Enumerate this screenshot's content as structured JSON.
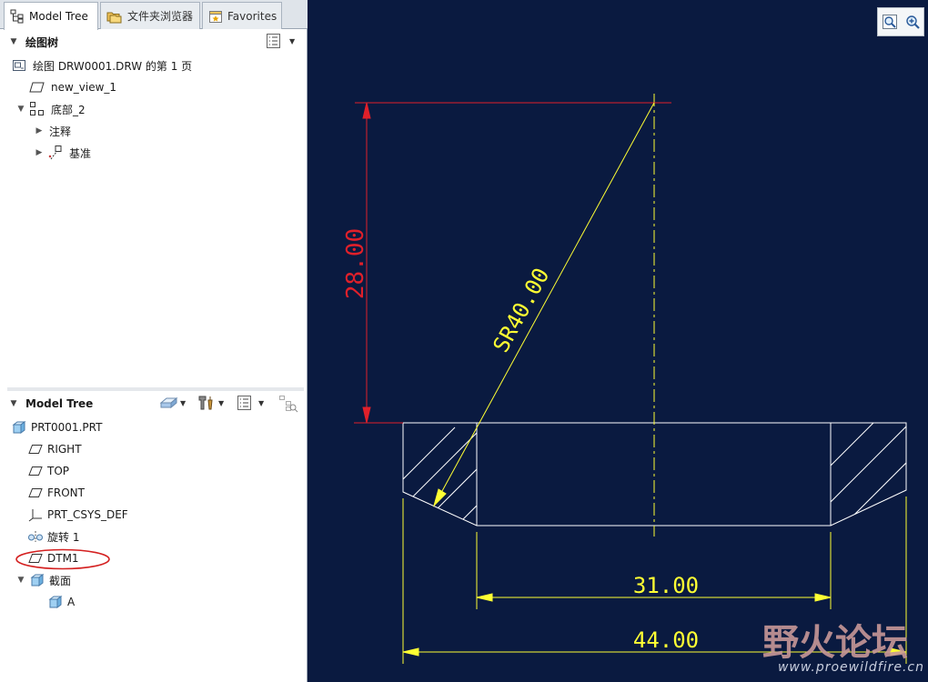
{
  "tabs": [
    {
      "label": "Model Tree",
      "icon": "model-tree-icon",
      "active": true
    },
    {
      "label": "文件夹浏览器",
      "icon": "folder-browser-icon",
      "active": false
    },
    {
      "label": "Favorites",
      "icon": "favorites-icon",
      "active": false
    }
  ],
  "drawing_tree": {
    "title": "绘图树",
    "items": [
      {
        "label": "绘图 DRW0001.DRW 的第 1 页",
        "icon": "drawing-sheet-icon"
      },
      {
        "label": "new_view_1",
        "icon": "view-icon"
      },
      {
        "label": "底部_2",
        "icon": "view-group-icon"
      },
      {
        "label": "注释",
        "icon": "annotation-icon"
      },
      {
        "label": "基准",
        "icon": "datum-icon"
      }
    ]
  },
  "model_tree": {
    "title": "Model Tree",
    "items": [
      {
        "label": "PRT0001.PRT",
        "icon": "part-icon"
      },
      {
        "label": "RIGHT",
        "icon": "datum-plane-icon"
      },
      {
        "label": "TOP",
        "icon": "datum-plane-icon"
      },
      {
        "label": "FRONT",
        "icon": "datum-plane-icon"
      },
      {
        "label": "PRT_CSYS_DEF",
        "icon": "csys-icon"
      },
      {
        "label": "旋转 1",
        "icon": "revolve-icon"
      },
      {
        "label": "DTM1",
        "icon": "datum-plane-icon"
      },
      {
        "label": "截面",
        "icon": "section-icon"
      },
      {
        "label": "A",
        "icon": "section-icon"
      }
    ]
  },
  "drawing": {
    "dim_height": "28.00",
    "dim_radius": "SR40.00",
    "dim_inner_width": "31.00",
    "dim_outer_width": "44.00"
  },
  "watermark": {
    "title": "野火论坛",
    "url": "www.proewildfire.cn"
  },
  "colors": {
    "canvas_bg": "#0a1a40",
    "dimension_yellow": "#ffff33",
    "dimension_red": "#e0202a",
    "geometry_white": "#ffffff",
    "highlight_red": "#d42020"
  }
}
